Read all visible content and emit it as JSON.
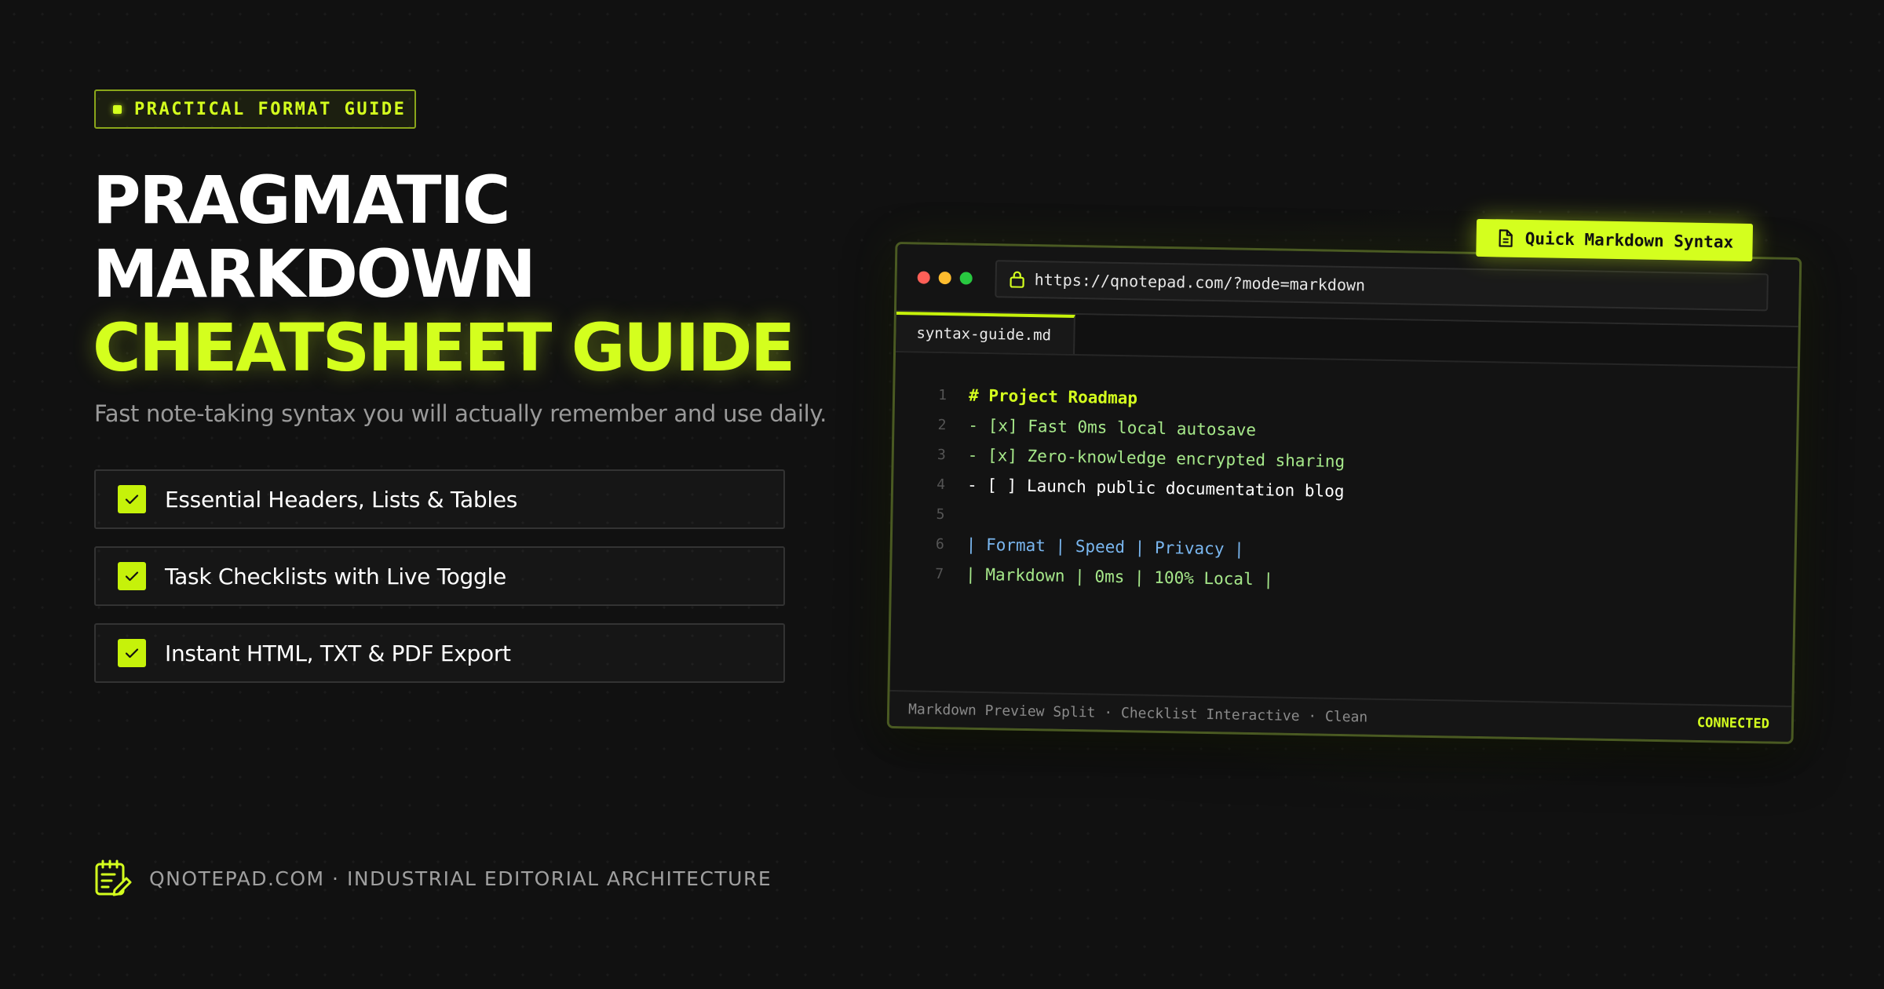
{
  "badge": {
    "label": "PRACTICAL FORMAT GUIDE"
  },
  "headline": {
    "line1": "PRAGMATIC",
    "line2": "MARKDOWN",
    "line3": "CHEATSHEET GUIDE"
  },
  "subtitle": "Fast note-taking syntax you will actually remember and use daily.",
  "features": [
    {
      "label": "Essential Headers, Lists & Tables"
    },
    {
      "label": "Task Checklists with Live Toggle"
    },
    {
      "label": "Instant HTML, TXT & PDF Export"
    }
  ],
  "footer": {
    "icon": "notepad-pen-icon",
    "text": "QNOTEPAD.COM · INDUSTRIAL EDITORIAL ARCHITECTURE"
  },
  "editor": {
    "url": "https://qnotepad.com/?mode=markdown",
    "tab": "syntax-guide.md",
    "pill": {
      "label": "Quick Markdown Syntax",
      "icon": "document-icon"
    },
    "lines": [
      {
        "n": "1",
        "text": "# Project Roadmap"
      },
      {
        "n": "2",
        "text": "- [x] Fast 0ms local autosave"
      },
      {
        "n": "3",
        "text": "- [x] Zero-knowledge encrypted sharing"
      },
      {
        "n": "4",
        "text": "- [ ] Launch public documentation blog"
      },
      {
        "n": "5",
        "text": ""
      },
      {
        "n": "6",
        "text": "| Format | Speed | Privacy |"
      },
      {
        "n": "7",
        "text": "| Markdown | 0ms | 100% Local |"
      }
    ],
    "status": {
      "left": "Markdown Preview Split · Checklist Interactive · Clean",
      "right": "CONNECTED"
    }
  },
  "colors": {
    "accent": "#d4ff1e",
    "background": "#111111",
    "done": "#a6e88a",
    "table_header": "#7ab7f0"
  }
}
